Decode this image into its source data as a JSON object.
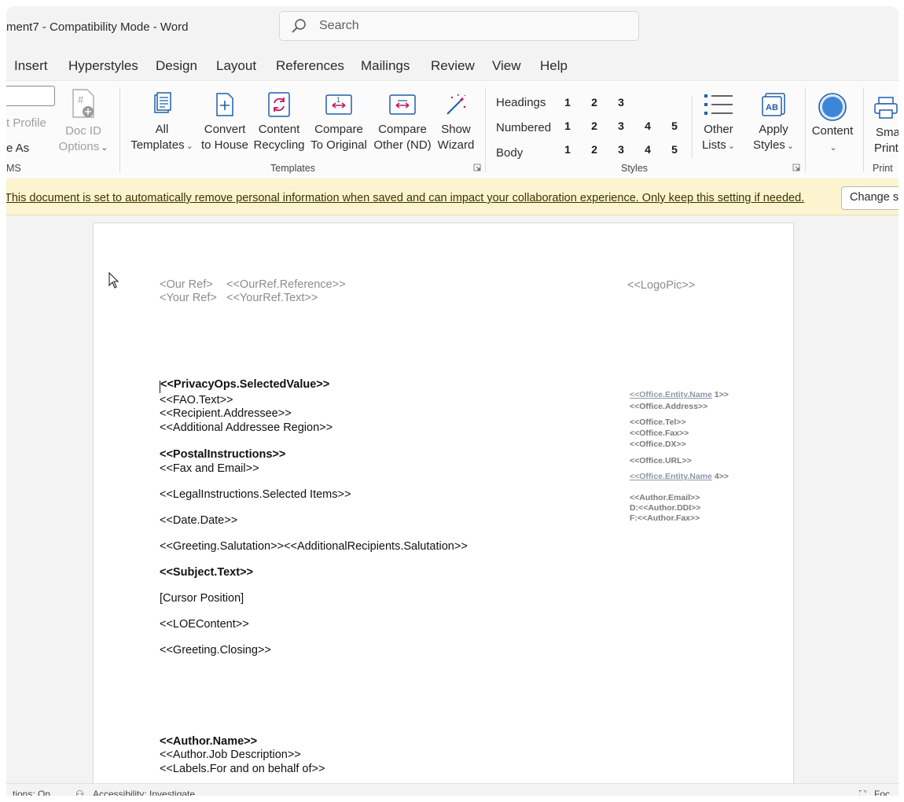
{
  "titlebar": {
    "title": "ment7  -  Compatibility Mode  -  Word",
    "search_placeholder": "Search"
  },
  "tabs": [
    "Insert",
    "Hyperstyles",
    "Design",
    "Layout",
    "References",
    "Mailings",
    "Review",
    "View",
    "Help"
  ],
  "ribbon": {
    "left_partial": {
      "profile": "t Profile",
      "save_as": "e As",
      "group": "MS"
    },
    "doc_id": {
      "line1": "Doc ID",
      "line2": "Options"
    },
    "templates": {
      "all": [
        "All",
        "Templates"
      ],
      "convert": [
        "Convert",
        "to House"
      ],
      "content_recycling": [
        "Content",
        "Recycling"
      ],
      "compare_original": [
        "Compare",
        "To Original"
      ],
      "compare_other": [
        "Compare",
        "Other (ND)"
      ],
      "show_wizard": [
        "Show",
        "Wizard"
      ],
      "group": "Templates"
    },
    "styles": {
      "rows": [
        {
          "label": "Headings",
          "nums": [
            "1",
            "2",
            "3"
          ]
        },
        {
          "label": "Numbered",
          "nums": [
            "1",
            "2",
            "3",
            "4",
            "5"
          ]
        },
        {
          "label": "Body",
          "nums": [
            "1",
            "2",
            "3",
            "4",
            "5"
          ]
        }
      ],
      "other_lists": [
        "Other",
        "Lists"
      ],
      "apply_styles": [
        "Apply",
        "Styles"
      ],
      "group": "Styles"
    },
    "content": {
      "label": "Content"
    },
    "print": {
      "smart": [
        "Sma",
        "Print"
      ],
      "group": "Print"
    },
    "colors": {
      "accent": "#1f5fa8",
      "icon_pink": "#c2185b"
    }
  },
  "message_bar": {
    "text": "This document is set to automatically remove personal information when saved and can impact your collaboration experience. Only keep this setting if needed.",
    "button": "Change se"
  },
  "document": {
    "our_ref_label": "<Our Ref>",
    "our_ref_value": "<<OurRef.Reference>>",
    "your_ref_label": "<Your Ref>",
    "your_ref_value": "<<YourRef.Text>>",
    "logo": "<<LogoPic>>",
    "privacy": "<<PrivacyOps.SelectedValue>>",
    "fao": "<<FAO.Text>>",
    "recipient": "<<Recipient.Addressee>>",
    "additional_addressee": "<<Additional Addressee Region>>",
    "postal": "<<PostalInstructions>>",
    "fax_email": "<<Fax and Email>>",
    "legal": "<<LegalInstructions.Selected Items>>",
    "date": "<<Date.Date>>",
    "greeting": "<<Greeting.Salutation>><<AdditionalRecipients.Salutation>>",
    "subject": "<<Subject.Text>>",
    "cursor_position": "[Cursor Position]",
    "loe": "<<LOEContent>>",
    "closing": "<<Greeting.Closing>>",
    "author_name": "<<Author.Name>>",
    "author_job": "<<Author.Job Description>>",
    "labels_behalf": "<<Labels.For and on behalf of>>",
    "sidebar": {
      "entity1_a": "<<Office.Entity.Name",
      "entity1_b": " 1>>",
      "address": "<<Office.Address>>",
      "tel": "<<Office.Tel>>",
      "fax": "<<Office.Fax>>",
      "dx": "<<Office.DX>>",
      "url": "<<Office.URL>>",
      "entity4_a": "<<Office.Entity.Name",
      "entity4_b": " 4>>",
      "author_email": "<<Author.Email>>",
      "author_ddi": "D:<<Author.DDI>>",
      "author_fax": "F:<<Author.Fax>>"
    }
  },
  "statusbar": {
    "left": "tions: On",
    "accessibility": "Accessibility: Investigate",
    "right": "Foc"
  }
}
